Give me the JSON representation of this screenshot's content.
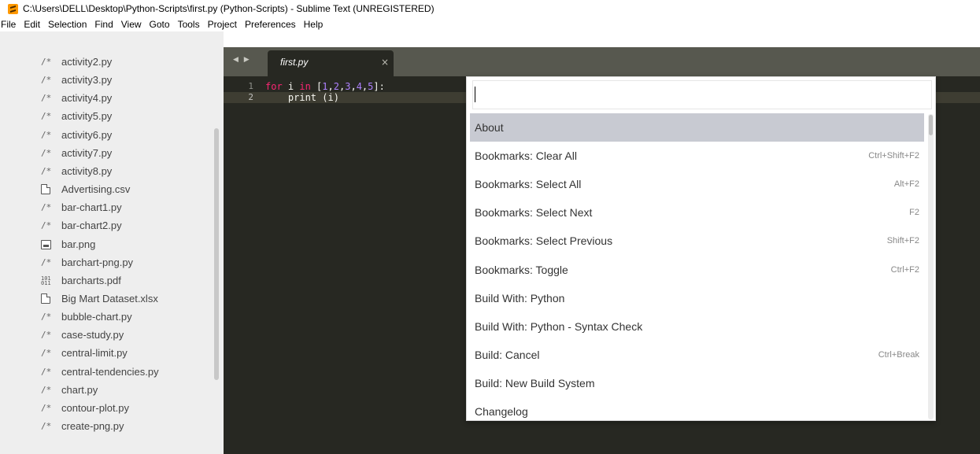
{
  "window": {
    "title": "C:\\Users\\DELL\\Desktop\\Python-Scripts\\first.py (Python-Scripts) - Sublime Text (UNREGISTERED)"
  },
  "menu": [
    "File",
    "Edit",
    "Selection",
    "Find",
    "View",
    "Goto",
    "Tools",
    "Project",
    "Preferences",
    "Help"
  ],
  "sidebar": {
    "files": [
      {
        "icon": "/*",
        "name": "activity2.py"
      },
      {
        "icon": "/*",
        "name": "activity3.py"
      },
      {
        "icon": "/*",
        "name": "activity4.py"
      },
      {
        "icon": "/*",
        "name": "activity5.py"
      },
      {
        "icon": "/*",
        "name": "activity6.py"
      },
      {
        "icon": "/*",
        "name": "activity7.py"
      },
      {
        "icon": "/*",
        "name": "activity8.py"
      },
      {
        "icon": "doc",
        "name": "Advertising.csv"
      },
      {
        "icon": "/*",
        "name": "bar-chart1.py"
      },
      {
        "icon": "/*",
        "name": "bar-chart2.py"
      },
      {
        "icon": "img",
        "name": "bar.png"
      },
      {
        "icon": "/*",
        "name": "barchart-png.py"
      },
      {
        "icon": "bin",
        "name": "barcharts.pdf"
      },
      {
        "icon": "doc",
        "name": "Big Mart Dataset.xlsx"
      },
      {
        "icon": "/*",
        "name": "bubble-chart.py"
      },
      {
        "icon": "/*",
        "name": "case-study.py"
      },
      {
        "icon": "/*",
        "name": "central-limit.py"
      },
      {
        "icon": "/*",
        "name": "central-tendencies.py"
      },
      {
        "icon": "/*",
        "name": "chart.py"
      },
      {
        "icon": "/*",
        "name": "contour-plot.py"
      },
      {
        "icon": "/*",
        "name": "create-png.py"
      }
    ]
  },
  "tabs": {
    "nav": "◀ ▶",
    "active": "first.py",
    "close": "×"
  },
  "editor": {
    "line_numbers": [
      "1",
      "2"
    ],
    "lines": [
      {
        "kw": "for",
        "text1": " i ",
        "kw2": "in",
        "text2": " [",
        "nums": [
          "1",
          "2",
          "3",
          "4",
          "5"
        ],
        "text3": "]:"
      },
      {
        "indent": "    ",
        "fn": "print",
        "rest": " (i)"
      }
    ]
  },
  "palette": {
    "input_value": "",
    "items": [
      {
        "label": "About",
        "shortcut": ""
      },
      {
        "label": "Bookmarks: Clear All",
        "shortcut": "Ctrl+Shift+F2"
      },
      {
        "label": "Bookmarks: Select All",
        "shortcut": "Alt+F2"
      },
      {
        "label": "Bookmarks: Select Next",
        "shortcut": "F2"
      },
      {
        "label": "Bookmarks: Select Previous",
        "shortcut": "Shift+F2"
      },
      {
        "label": "Bookmarks: Toggle",
        "shortcut": "Ctrl+F2"
      },
      {
        "label": "Build With: Python",
        "shortcut": ""
      },
      {
        "label": "Build With: Python - Syntax Check",
        "shortcut": ""
      },
      {
        "label": "Build: Cancel",
        "shortcut": "Ctrl+Break"
      },
      {
        "label": "Build: New Build System",
        "shortcut": ""
      },
      {
        "label": "Changelog",
        "shortcut": ""
      }
    ]
  },
  "colors": {
    "editor_bg": "#272822",
    "tabbar_bg": "#57584f",
    "sidebar_bg": "#eeeeee",
    "keyword": "#f92672",
    "number": "#ae81ff",
    "palette_selected": "#c8cad2",
    "app_icon": "#ff9800"
  }
}
